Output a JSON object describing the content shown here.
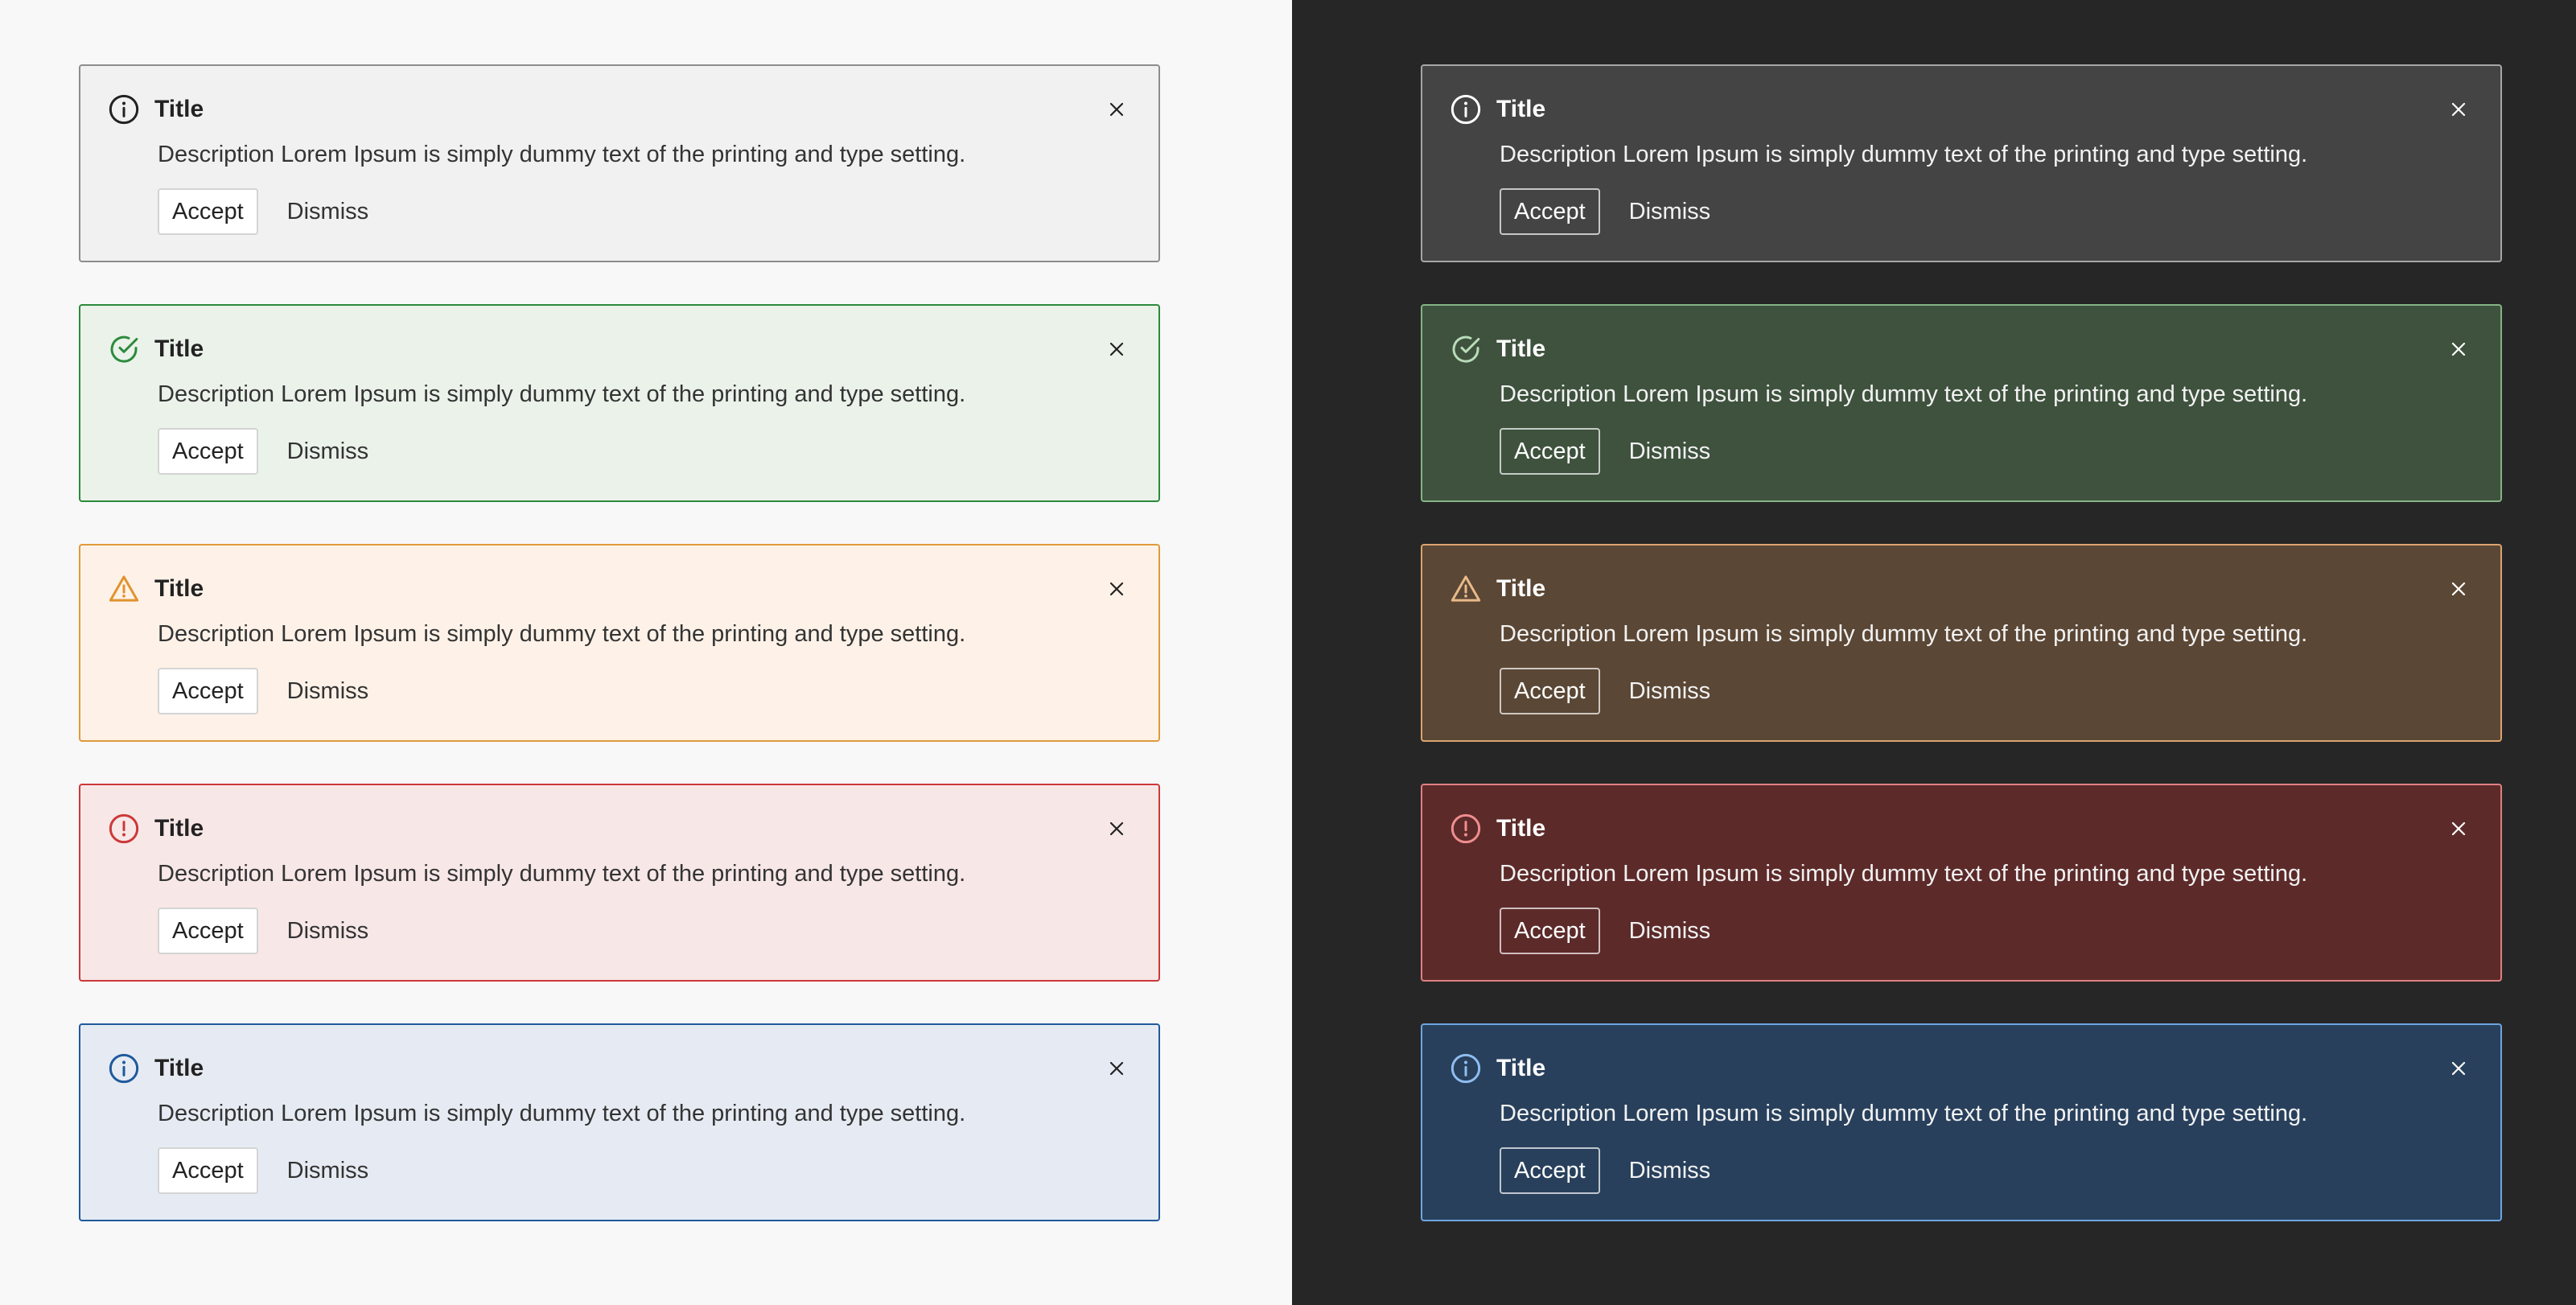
{
  "themes": {
    "light": {
      "alerts": [
        {
          "variant": "neutral",
          "icon": "info-icon",
          "icon_color": "#222222",
          "title": "Title",
          "description": "Description Lorem Ipsum is simply dummy text of the printing and type setting.",
          "accept_label": "Accept",
          "dismiss_label": "Dismiss"
        },
        {
          "variant": "success",
          "icon": "check-circle-icon",
          "icon_color": "#2c8a3c",
          "title": "Title",
          "description": "Description Lorem Ipsum is simply dummy text of the printing and type setting.",
          "accept_label": "Accept",
          "dismiss_label": "Dismiss"
        },
        {
          "variant": "warning",
          "icon": "warning-triangle-icon",
          "icon_color": "#e0932e",
          "title": "Title",
          "description": "Description Lorem Ipsum is simply dummy text of the printing and type setting.",
          "accept_label": "Accept",
          "dismiss_label": "Dismiss"
        },
        {
          "variant": "error",
          "icon": "error-circle-icon",
          "icon_color": "#cc3939",
          "title": "Title",
          "description": "Description Lorem Ipsum is simply dummy text of the printing and type setting.",
          "accept_label": "Accept",
          "dismiss_label": "Dismiss"
        },
        {
          "variant": "info",
          "icon": "info-icon",
          "icon_color": "#1f5a9c",
          "title": "Title",
          "description": "Description Lorem Ipsum is simply dummy text of the printing and type setting.",
          "accept_label": "Accept",
          "dismiss_label": "Dismiss"
        }
      ]
    },
    "dark": {
      "alerts": [
        {
          "variant": "neutral",
          "icon": "info-icon",
          "icon_color": "#ffffff",
          "title": "Title",
          "description": "Description Lorem Ipsum is simply dummy text of the printing and type setting.",
          "accept_label": "Accept",
          "dismiss_label": "Dismiss"
        },
        {
          "variant": "success",
          "icon": "check-circle-icon",
          "icon_color": "#b9dcb9",
          "title": "Title",
          "description": "Description Lorem Ipsum is simply dummy text of the printing and type setting.",
          "accept_label": "Accept",
          "dismiss_label": "Dismiss"
        },
        {
          "variant": "warning",
          "icon": "warning-triangle-icon",
          "icon_color": "#e8b98a",
          "title": "Title",
          "description": "Description Lorem Ipsum is simply dummy text of the printing and type setting.",
          "accept_label": "Accept",
          "dismiss_label": "Dismiss"
        },
        {
          "variant": "error",
          "icon": "error-circle-icon",
          "icon_color": "#ef8e8e",
          "title": "Title",
          "description": "Description Lorem Ipsum is simply dummy text of the printing and type setting.",
          "accept_label": "Accept",
          "dismiss_label": "Dismiss"
        },
        {
          "variant": "info",
          "icon": "info-icon",
          "icon_color": "#8fbdf0",
          "title": "Title",
          "description": "Description Lorem Ipsum is simply dummy text of the printing and type setting.",
          "accept_label": "Accept",
          "dismiss_label": "Dismiss"
        }
      ]
    }
  }
}
